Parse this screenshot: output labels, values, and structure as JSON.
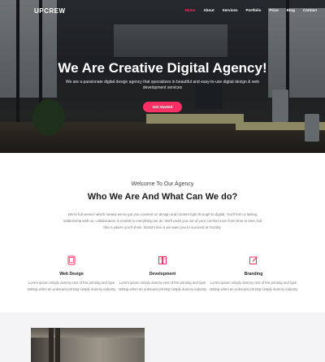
{
  "brand": {
    "logo": "UPCREW"
  },
  "nav": [
    "Home",
    "About",
    "Services",
    "Portfolio",
    "Price",
    "Blog",
    "Contact"
  ],
  "hero": {
    "title": "We Are Creative Digital Agency!",
    "subtitle": "We are a passionate digital design agency that specializes in beautiful and easy-to-use digital design & web development services",
    "button": "Get Started"
  },
  "about": {
    "kicker": "Welcome To Our Agency",
    "title": "Who We Are And What Can We do?",
    "text": "We're full service which means we've got you covered on design and content right through to digital. You'll form a lasting relationship with us, collaboration is central to everything we do. We'll push you out of your comfort zone from time to time, but this is where you'll shine. Bottom line is we want you to succeed at Faculty."
  },
  "services": [
    {
      "name": "Web Design",
      "desc": "Lorem ipsum simply dummy text of the printing and type setting when an unknown printing simply dummy industry",
      "icon": "tablet-icon"
    },
    {
      "name": "Development",
      "desc": "Lorem ipsum simply dummy text of the printing and type setting when an unknown printing simply dummy industry",
      "icon": "columns-icon"
    },
    {
      "name": "Branding",
      "desc": "Lorem ipsum simply dummy text of the printing and type setting when an unknown printing simply dummy industry",
      "icon": "edit-icon"
    }
  ],
  "colors": {
    "accent": "#ff2e63",
    "heading": "#1a1a1a",
    "body": "#777777"
  }
}
